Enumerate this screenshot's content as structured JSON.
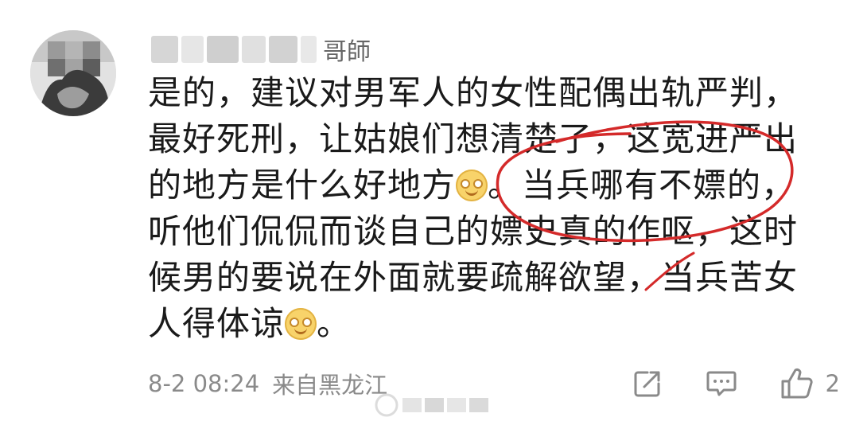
{
  "comment": {
    "username": "哥師",
    "lines": [
      "是的，建议对男军人的女性配偶出轨严判，",
      "最好死刑，让姑娘们想清楚了，这宽进严出",
      "的地方是什么好地方",
      "。当兵哪有不嫖的，",
      "听他们侃侃而谈自己的嫖史真的作呕，这时",
      "候男的要说在外面就要疏解欲望，当兵苦女",
      "人得体谅",
      "。"
    ],
    "timestamp": "8-2 08:24",
    "location": "来自黑龙江",
    "like_count": "2"
  },
  "icons": {
    "repost": "repost-icon",
    "comment": "comment-icon",
    "like": "thumbs-up-icon"
  },
  "colors": {
    "annotation": "#d42a2a",
    "meta_text": "#8a8a8a",
    "body_text": "#1a1a1a"
  }
}
